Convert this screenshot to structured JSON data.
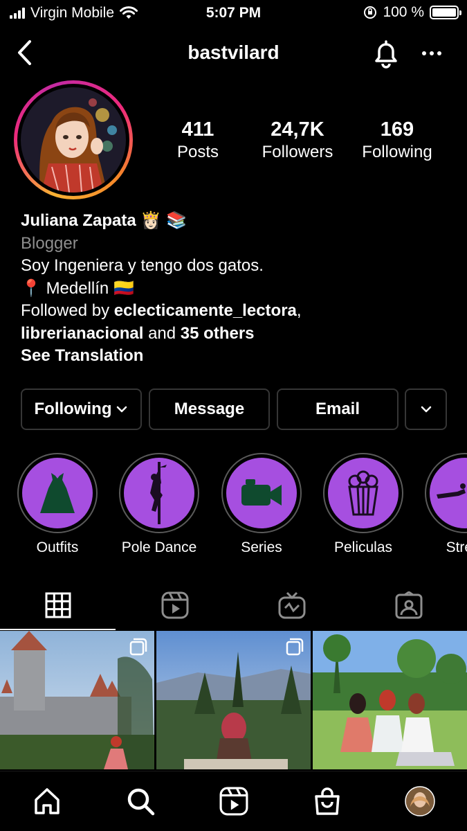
{
  "status_bar": {
    "carrier": "Virgin Mobile",
    "time": "5:07 PM",
    "battery_text": "100 %"
  },
  "header": {
    "username": "bastvilard"
  },
  "stats": {
    "posts_count": "411",
    "posts_label": "Posts",
    "followers_count": "24,7K",
    "followers_label": "Followers",
    "following_count": "169",
    "following_label": "Following"
  },
  "bio": {
    "name": "Juliana Zapata",
    "name_emoji": "👸🏻 📚",
    "category": "Blogger",
    "line1": "Soy Ingeniera y tengo dos gatos.",
    "location_pin": "📍",
    "location": "Medellín",
    "location_flag": "🇨🇴",
    "followed_by_prefix": "Followed by ",
    "followed_user1": "eclecticamente_lectora",
    "followed_comma": ",",
    "followed_user2": "librerianacional",
    "followed_and": " and ",
    "followed_others": "35 others",
    "see_translation": "See Translation"
  },
  "buttons": {
    "following": "Following",
    "message": "Message",
    "email": "Email"
  },
  "highlights": [
    {
      "label": "Outfits",
      "icon": "dress-icon"
    },
    {
      "label": "Pole Dance",
      "icon": "pole-dancer-icon"
    },
    {
      "label": "Series",
      "icon": "video-camera-icon"
    },
    {
      "label": "Peliculas",
      "icon": "popcorn-icon"
    },
    {
      "label": "Stretc",
      "icon": "stretch-icon"
    }
  ],
  "tabs": [
    "grid-icon",
    "reels-icon",
    "igtv-icon",
    "tagged-icon"
  ],
  "bottom_nav": [
    "home-icon",
    "search-icon",
    "reels-icon",
    "shop-icon",
    "profile-avatar"
  ],
  "colors": {
    "highlight_bg": "#a64fe0",
    "background": "#000000",
    "border": "#363636",
    "category_text": "#8e8e8e"
  }
}
